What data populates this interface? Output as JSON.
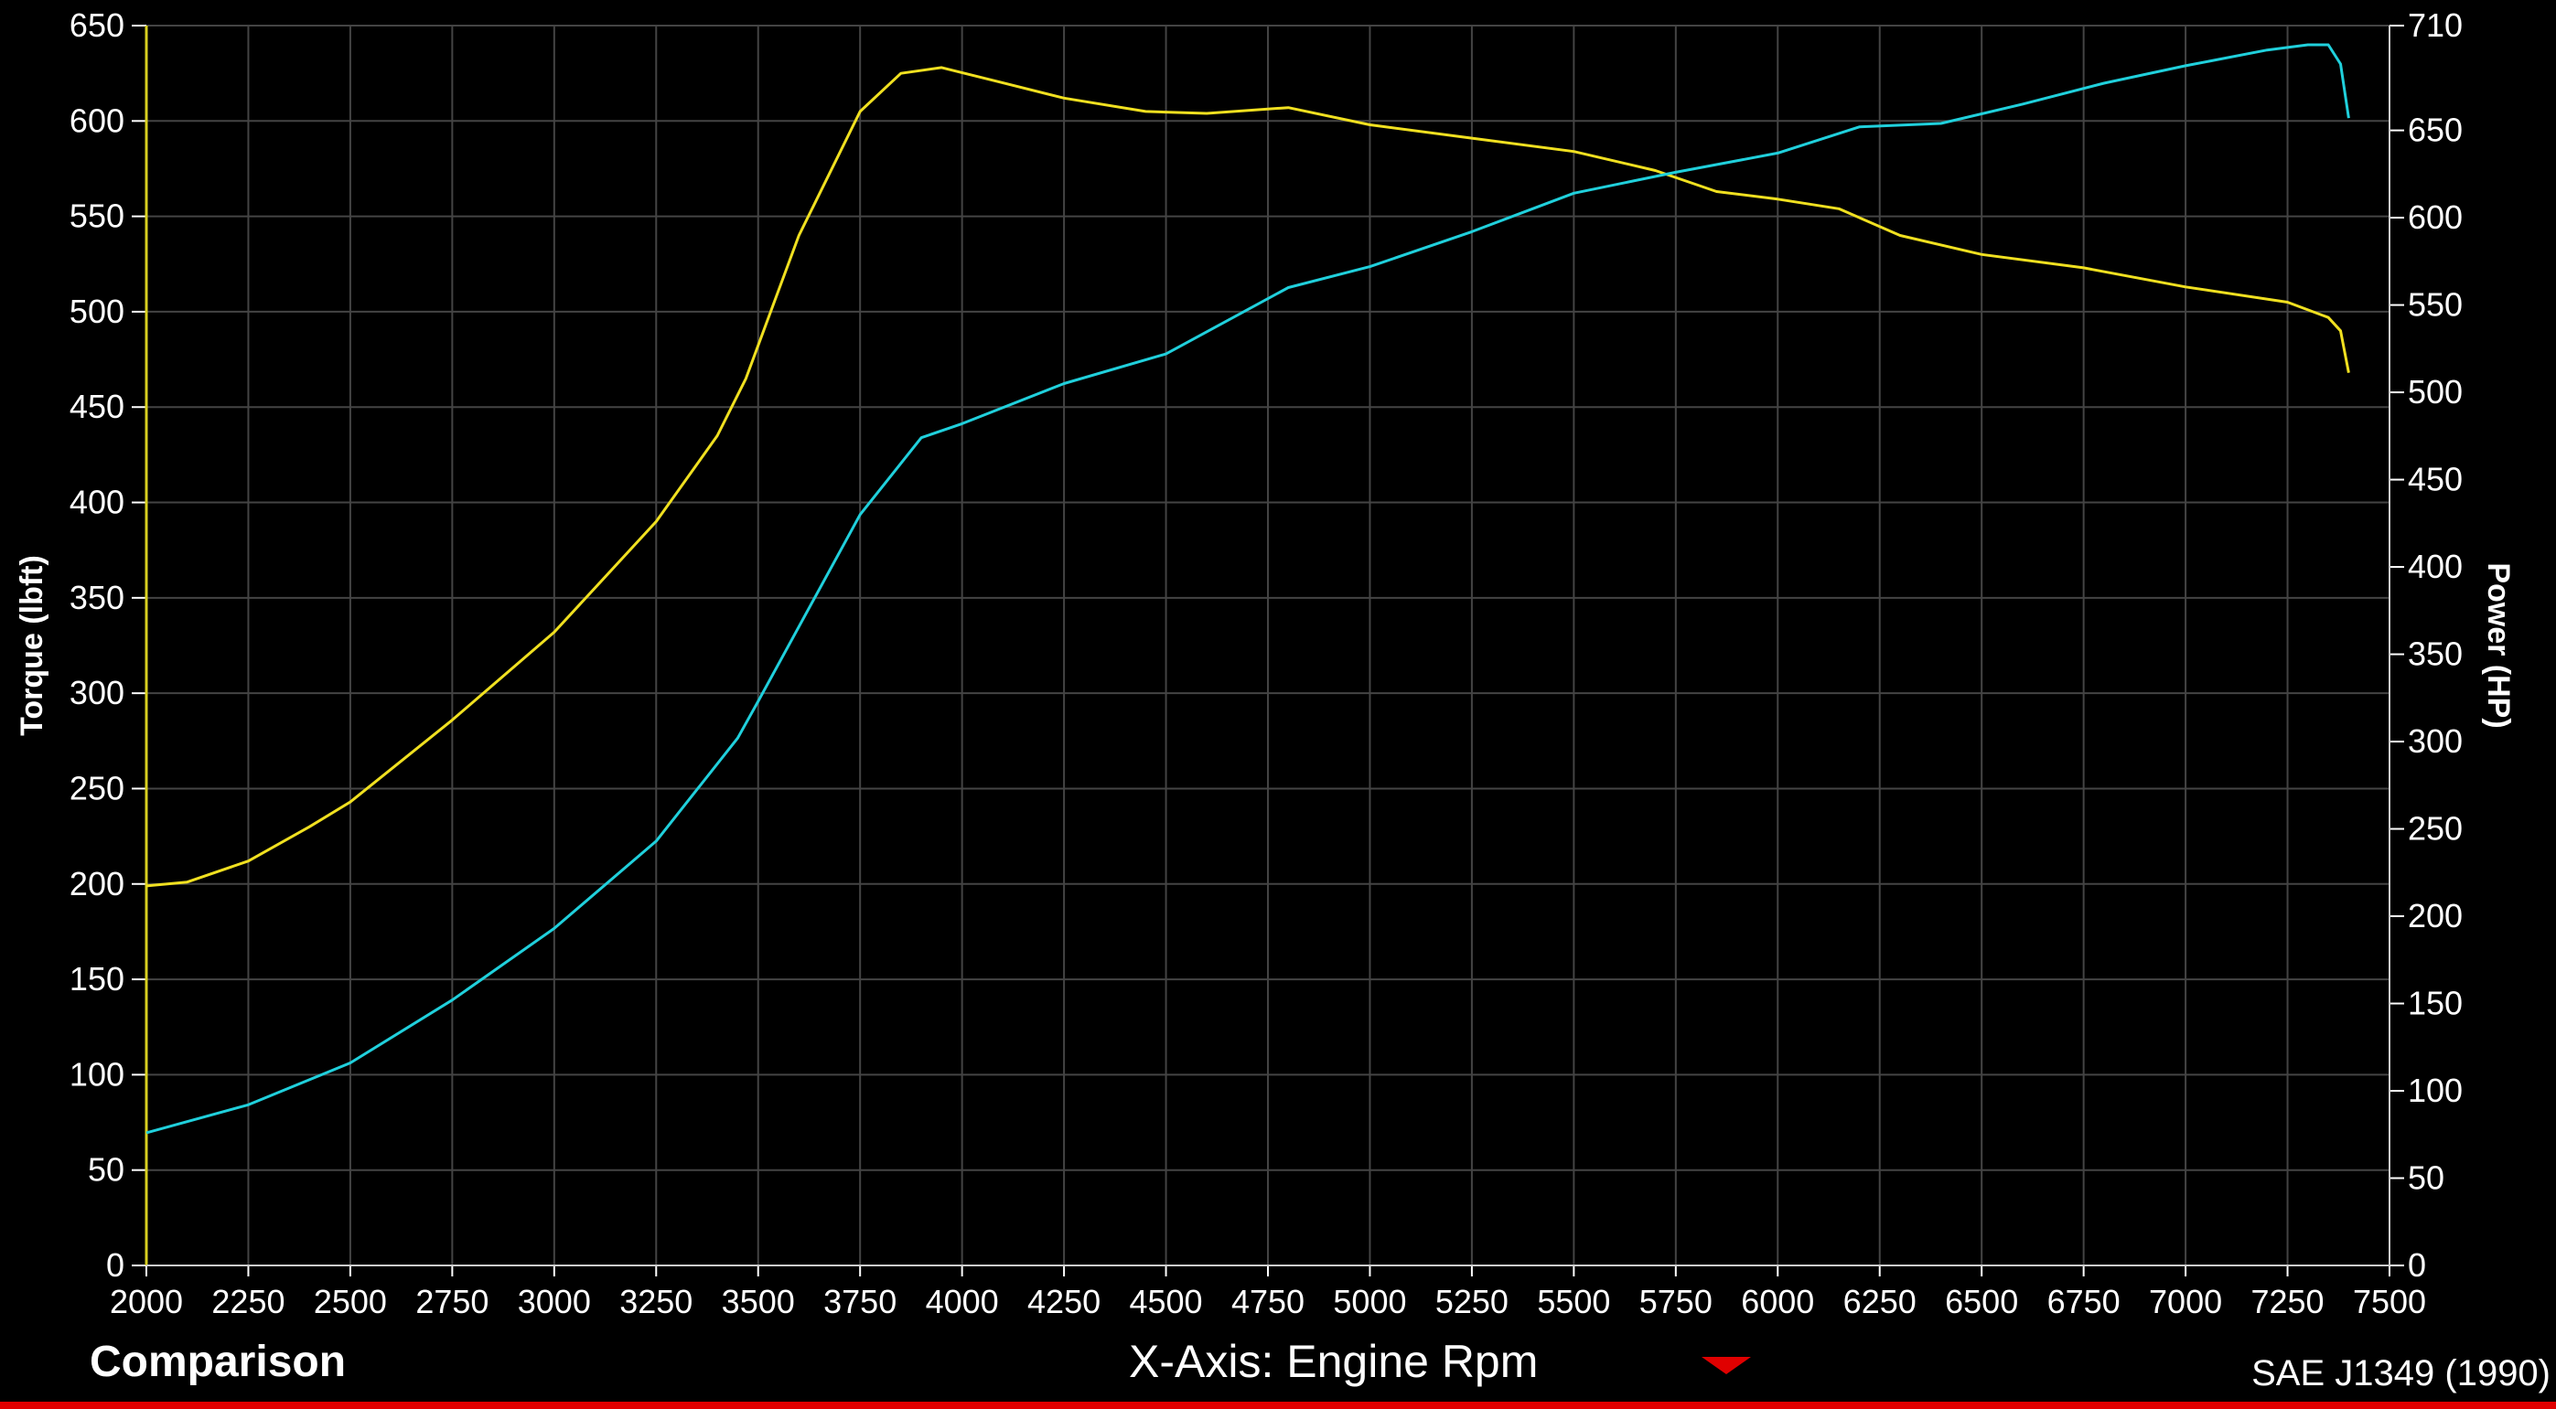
{
  "footer": {
    "left_label": "Comparison",
    "xaxis_label": "X-Axis: Engine Rpm",
    "standard": "SAE J1349 (1990)"
  },
  "colors": {
    "background": "#000000",
    "grid": "#444444",
    "torque": "#f0e020",
    "power": "#20d0dc",
    "axis_line": "#d8d020",
    "dropdown": "#e00000"
  },
  "icons": {
    "xaxis_dropdown": "triangle-down-icon"
  },
  "chart_data": {
    "type": "line",
    "x_label": "",
    "y_left_label": "Torque (lbft)",
    "y_right_label": "Power (HP)",
    "xlim": [
      2000,
      7500
    ],
    "ylim_left": [
      0,
      650
    ],
    "ylim_right": [
      0,
      710
    ],
    "x_ticks": [
      2000,
      2250,
      2500,
      2750,
      3000,
      3250,
      3500,
      3750,
      4000,
      4250,
      4500,
      4750,
      5000,
      5250,
      5500,
      5750,
      6000,
      6250,
      6500,
      6750,
      7000,
      7250,
      7500
    ],
    "y_left_ticks": [
      0,
      50,
      100,
      150,
      200,
      250,
      300,
      350,
      400,
      450,
      500,
      550,
      600,
      650
    ],
    "y_right_ticks": [
      0,
      50,
      100,
      150,
      200,
      250,
      300,
      350,
      400,
      450,
      500,
      550,
      600,
      650,
      710
    ],
    "grid": true,
    "series": [
      {
        "axis": "left",
        "color": "#f0e020",
        "points": [
          [
            2000,
            199
          ],
          [
            2100,
            201
          ],
          [
            2250,
            212
          ],
          [
            2400,
            230
          ],
          [
            2500,
            243
          ],
          [
            2750,
            286
          ],
          [
            3000,
            332
          ],
          [
            3250,
            390
          ],
          [
            3400,
            435
          ],
          [
            3470,
            465
          ],
          [
            3600,
            540
          ],
          [
            3750,
            605
          ],
          [
            3850,
            625
          ],
          [
            3950,
            628
          ],
          [
            4100,
            620
          ],
          [
            4250,
            612
          ],
          [
            4450,
            605
          ],
          [
            4600,
            604
          ],
          [
            4800,
            607
          ],
          [
            5000,
            598
          ],
          [
            5250,
            591
          ],
          [
            5500,
            584
          ],
          [
            5700,
            574
          ],
          [
            5850,
            563
          ],
          [
            6000,
            559
          ],
          [
            6150,
            554
          ],
          [
            6300,
            540
          ],
          [
            6500,
            530
          ],
          [
            6750,
            523
          ],
          [
            7000,
            513
          ],
          [
            7250,
            505
          ],
          [
            7350,
            497
          ],
          [
            7380,
            490
          ],
          [
            7400,
            468
          ]
        ]
      },
      {
        "axis": "right",
        "color": "#20d0dc",
        "points": [
          [
            2000,
            76
          ],
          [
            2250,
            92
          ],
          [
            2500,
            116
          ],
          [
            2750,
            152
          ],
          [
            3000,
            193
          ],
          [
            3250,
            243
          ],
          [
            3450,
            302
          ],
          [
            3500,
            323
          ],
          [
            3750,
            430
          ],
          [
            3900,
            474
          ],
          [
            4000,
            482
          ],
          [
            4250,
            505
          ],
          [
            4500,
            522
          ],
          [
            4800,
            560
          ],
          [
            5000,
            572
          ],
          [
            5250,
            592
          ],
          [
            5500,
            614
          ],
          [
            5750,
            626
          ],
          [
            6000,
            637
          ],
          [
            6200,
            652
          ],
          [
            6400,
            654
          ],
          [
            6600,
            665
          ],
          [
            6800,
            677
          ],
          [
            7000,
            687
          ],
          [
            7200,
            696
          ],
          [
            7300,
            699
          ],
          [
            7350,
            699
          ],
          [
            7380,
            688
          ],
          [
            7400,
            657
          ]
        ]
      }
    ]
  }
}
